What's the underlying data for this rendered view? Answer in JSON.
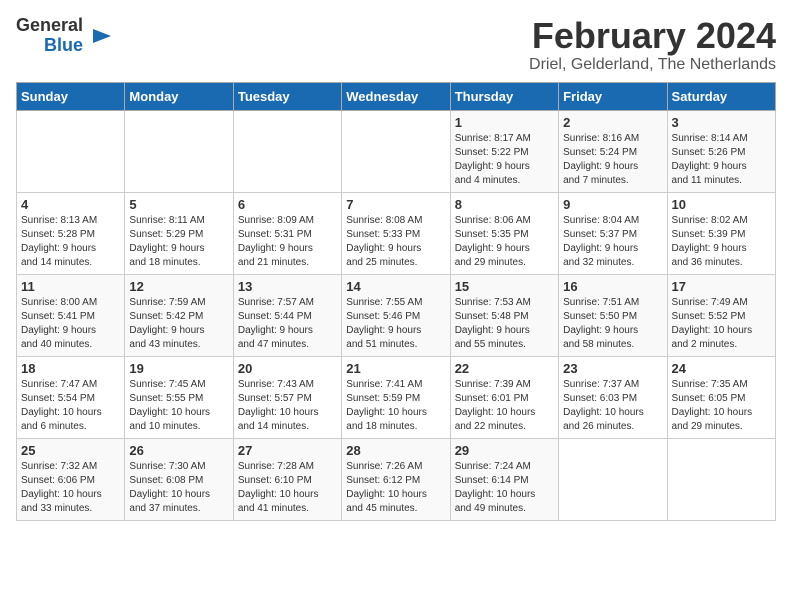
{
  "logo": {
    "line1": "General",
    "line2": "Blue"
  },
  "title": "February 2024",
  "subtitle": "Driel, Gelderland, The Netherlands",
  "days_of_week": [
    "Sunday",
    "Monday",
    "Tuesday",
    "Wednesday",
    "Thursday",
    "Friday",
    "Saturday"
  ],
  "weeks": [
    [
      {
        "day": "",
        "info": ""
      },
      {
        "day": "",
        "info": ""
      },
      {
        "day": "",
        "info": ""
      },
      {
        "day": "",
        "info": ""
      },
      {
        "day": "1",
        "info": "Sunrise: 8:17 AM\nSunset: 5:22 PM\nDaylight: 9 hours\nand 4 minutes."
      },
      {
        "day": "2",
        "info": "Sunrise: 8:16 AM\nSunset: 5:24 PM\nDaylight: 9 hours\nand 7 minutes."
      },
      {
        "day": "3",
        "info": "Sunrise: 8:14 AM\nSunset: 5:26 PM\nDaylight: 9 hours\nand 11 minutes."
      }
    ],
    [
      {
        "day": "4",
        "info": "Sunrise: 8:13 AM\nSunset: 5:28 PM\nDaylight: 9 hours\nand 14 minutes."
      },
      {
        "day": "5",
        "info": "Sunrise: 8:11 AM\nSunset: 5:29 PM\nDaylight: 9 hours\nand 18 minutes."
      },
      {
        "day": "6",
        "info": "Sunrise: 8:09 AM\nSunset: 5:31 PM\nDaylight: 9 hours\nand 21 minutes."
      },
      {
        "day": "7",
        "info": "Sunrise: 8:08 AM\nSunset: 5:33 PM\nDaylight: 9 hours\nand 25 minutes."
      },
      {
        "day": "8",
        "info": "Sunrise: 8:06 AM\nSunset: 5:35 PM\nDaylight: 9 hours\nand 29 minutes."
      },
      {
        "day": "9",
        "info": "Sunrise: 8:04 AM\nSunset: 5:37 PM\nDaylight: 9 hours\nand 32 minutes."
      },
      {
        "day": "10",
        "info": "Sunrise: 8:02 AM\nSunset: 5:39 PM\nDaylight: 9 hours\nand 36 minutes."
      }
    ],
    [
      {
        "day": "11",
        "info": "Sunrise: 8:00 AM\nSunset: 5:41 PM\nDaylight: 9 hours\nand 40 minutes."
      },
      {
        "day": "12",
        "info": "Sunrise: 7:59 AM\nSunset: 5:42 PM\nDaylight: 9 hours\nand 43 minutes."
      },
      {
        "day": "13",
        "info": "Sunrise: 7:57 AM\nSunset: 5:44 PM\nDaylight: 9 hours\nand 47 minutes."
      },
      {
        "day": "14",
        "info": "Sunrise: 7:55 AM\nSunset: 5:46 PM\nDaylight: 9 hours\nand 51 minutes."
      },
      {
        "day": "15",
        "info": "Sunrise: 7:53 AM\nSunset: 5:48 PM\nDaylight: 9 hours\nand 55 minutes."
      },
      {
        "day": "16",
        "info": "Sunrise: 7:51 AM\nSunset: 5:50 PM\nDaylight: 9 hours\nand 58 minutes."
      },
      {
        "day": "17",
        "info": "Sunrise: 7:49 AM\nSunset: 5:52 PM\nDaylight: 10 hours\nand 2 minutes."
      }
    ],
    [
      {
        "day": "18",
        "info": "Sunrise: 7:47 AM\nSunset: 5:54 PM\nDaylight: 10 hours\nand 6 minutes."
      },
      {
        "day": "19",
        "info": "Sunrise: 7:45 AM\nSunset: 5:55 PM\nDaylight: 10 hours\nand 10 minutes."
      },
      {
        "day": "20",
        "info": "Sunrise: 7:43 AM\nSunset: 5:57 PM\nDaylight: 10 hours\nand 14 minutes."
      },
      {
        "day": "21",
        "info": "Sunrise: 7:41 AM\nSunset: 5:59 PM\nDaylight: 10 hours\nand 18 minutes."
      },
      {
        "day": "22",
        "info": "Sunrise: 7:39 AM\nSunset: 6:01 PM\nDaylight: 10 hours\nand 22 minutes."
      },
      {
        "day": "23",
        "info": "Sunrise: 7:37 AM\nSunset: 6:03 PM\nDaylight: 10 hours\nand 26 minutes."
      },
      {
        "day": "24",
        "info": "Sunrise: 7:35 AM\nSunset: 6:05 PM\nDaylight: 10 hours\nand 29 minutes."
      }
    ],
    [
      {
        "day": "25",
        "info": "Sunrise: 7:32 AM\nSunset: 6:06 PM\nDaylight: 10 hours\nand 33 minutes."
      },
      {
        "day": "26",
        "info": "Sunrise: 7:30 AM\nSunset: 6:08 PM\nDaylight: 10 hours\nand 37 minutes."
      },
      {
        "day": "27",
        "info": "Sunrise: 7:28 AM\nSunset: 6:10 PM\nDaylight: 10 hours\nand 41 minutes."
      },
      {
        "day": "28",
        "info": "Sunrise: 7:26 AM\nSunset: 6:12 PM\nDaylight: 10 hours\nand 45 minutes."
      },
      {
        "day": "29",
        "info": "Sunrise: 7:24 AM\nSunset: 6:14 PM\nDaylight: 10 hours\nand 49 minutes."
      },
      {
        "day": "",
        "info": ""
      },
      {
        "day": "",
        "info": ""
      }
    ]
  ]
}
